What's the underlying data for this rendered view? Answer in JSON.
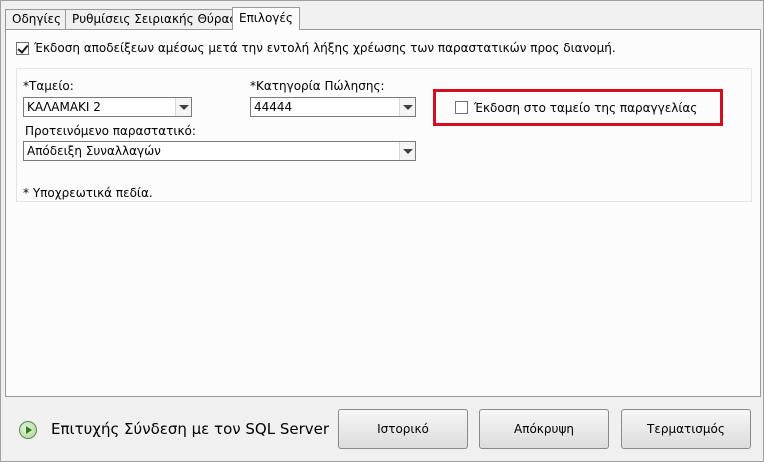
{
  "tabs": [
    {
      "label": "Οδηγίες",
      "active": false
    },
    {
      "label": "Ρυθμίσεις Σειριακής Θύρας",
      "active": false
    },
    {
      "label": "Επιλογές",
      "active": true
    }
  ],
  "options": {
    "issue_receipts": {
      "checked": true,
      "label": "Έκδοση αποδείξεων αμέσως μετά την εντολή λήξης χρέωσης των παραστατικών προς διανομή."
    },
    "cashier": {
      "label": "Ταμείο:",
      "required_mark": "*",
      "value": "ΚΑΛΑΜΑΚΙ 2"
    },
    "sales_category": {
      "label": "Κατηγορία Πώλησης:",
      "required_mark": "*",
      "value": "44444"
    },
    "issue_at_order_cashier": {
      "checked": false,
      "label": "Έκδοση στο ταμείο της παραγγελίας"
    },
    "suggested_document": {
      "label": "Προτεινόμενο παραστατικό:",
      "value": "Απόδειξη Συναλλαγών"
    },
    "required_note": "* Υποχρεωτικά πεδία."
  },
  "status": {
    "icon": "play-circle-icon",
    "text": "Επιτυχής Σύνδεση με τον SQL Server"
  },
  "buttons": {
    "history": "Ιστορικό",
    "hide": "Απόκρυψη",
    "terminate": "Τερματισμός"
  },
  "colors": {
    "highlight": "#d01020",
    "status_icon": "#2e7a20"
  }
}
